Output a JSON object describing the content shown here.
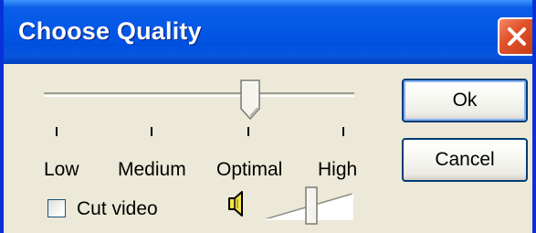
{
  "window": {
    "title": "Choose Quality"
  },
  "quality_slider": {
    "selected": "Optimal",
    "level_fraction": 0.67,
    "tick_labels": [
      "Low",
      "Medium",
      "Optimal",
      "High"
    ]
  },
  "buttons": {
    "ok_label": "Ok",
    "cancel_label": "Cancel"
  },
  "cut_video": {
    "label": "Cut video",
    "checked": false
  },
  "volume": {
    "icon": "speaker-icon",
    "level_fraction": 0.5
  },
  "colors": {
    "titlebar": "#0358e6",
    "close_button": "#e1532a",
    "dialog_background": "#ece9d8"
  }
}
